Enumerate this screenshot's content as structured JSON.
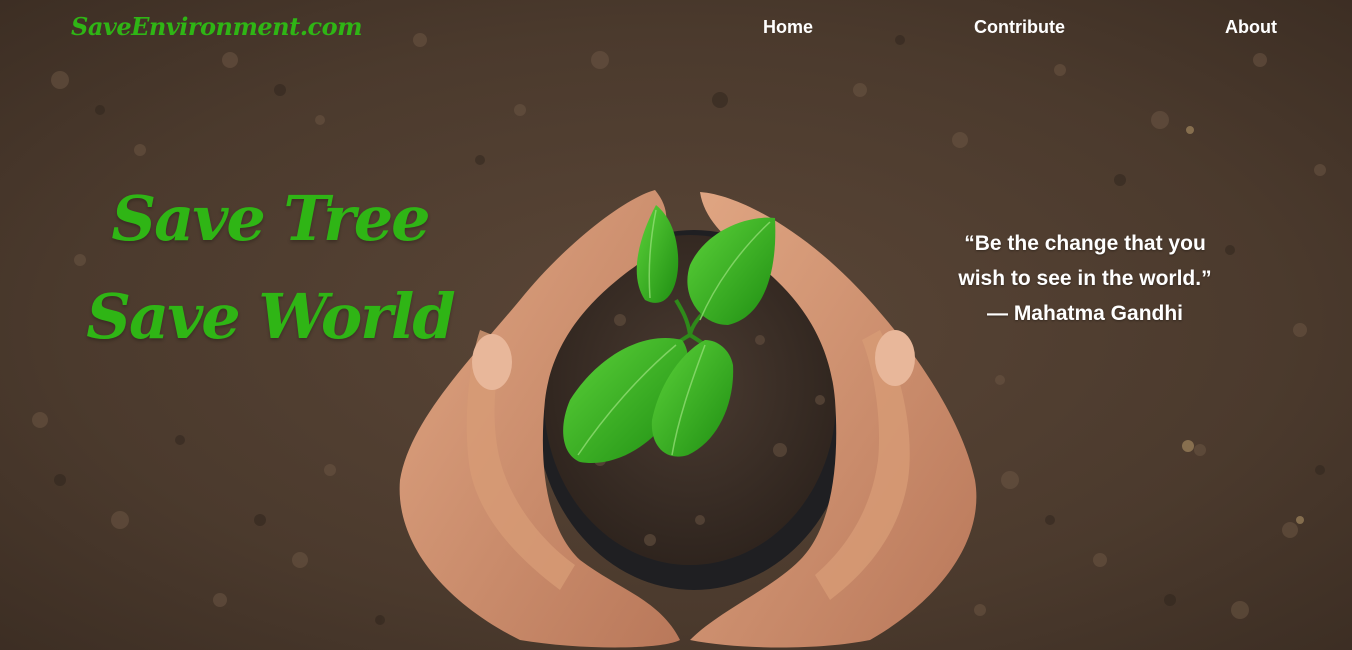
{
  "nav": {
    "brand": "SaveEnvironment.com",
    "links": [
      "Home",
      "Contribute",
      "About"
    ]
  },
  "hero": {
    "headline_line1": "Save Tree",
    "headline_line2": "Save World",
    "quote_line1": "“Be the change that you",
    "quote_line2": "wish to see in the world.”",
    "quote_author": "— Mahatma Gandhi",
    "image": "hands-holding-seedling-in-soil"
  },
  "colors": {
    "brand_green": "#2fb515",
    "nav_text": "#ffffff",
    "soil": "#4a3a2e"
  }
}
